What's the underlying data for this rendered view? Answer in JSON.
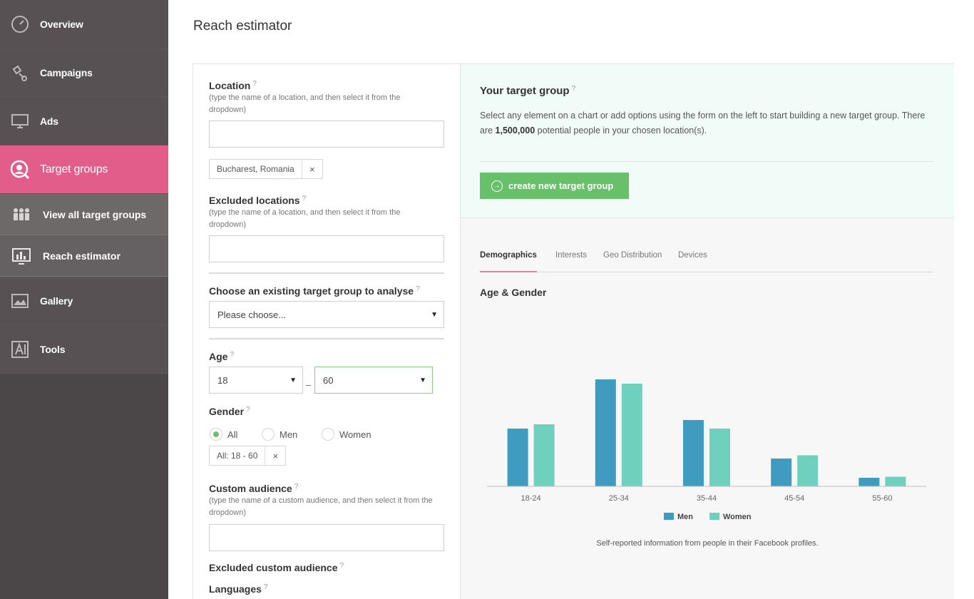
{
  "sidebar": {
    "items": [
      {
        "label": "Overview",
        "icon": "dashboard-gauge-icon"
      },
      {
        "label": "Campaigns",
        "icon": "satellite-icon"
      },
      {
        "label": "Ads",
        "icon": "monitor-icon"
      },
      {
        "label": "Target groups",
        "icon": "target-person-icon",
        "active": true
      },
      {
        "label": "View all target groups",
        "icon": "people-group-icon",
        "sub": true
      },
      {
        "label": "Reach estimator",
        "icon": "bar-chart-screen-icon",
        "sub": true,
        "current": true
      },
      {
        "label": "Gallery",
        "icon": "image-icon"
      },
      {
        "label": "Tools",
        "icon": "tools-icon"
      }
    ]
  },
  "page": {
    "title": "Reach estimator"
  },
  "form": {
    "location": {
      "label": "Location",
      "help": "?",
      "hint": "(type the name of a location, and then select it from the dropdown)",
      "value": ""
    },
    "location_tag": {
      "text": "Bucharest, Romania",
      "remove": "×"
    },
    "excluded_locations": {
      "label": "Excluded locations",
      "help": "?",
      "hint": "(type the name of a location, and then select it from the dropdown)",
      "value": ""
    },
    "existing_group": {
      "label": "Choose an existing target group to analyse",
      "help": "?",
      "selected": "Please choose..."
    },
    "age": {
      "label": "Age",
      "help": "?",
      "from": "18",
      "to": "60",
      "separator": "–"
    },
    "gender": {
      "label": "Gender",
      "help": "?",
      "options": [
        "All",
        "Men",
        "Women"
      ],
      "selected": "All"
    },
    "gender_tag": {
      "text": "All: 18 - 60",
      "remove": "×"
    },
    "custom_audience": {
      "label": "Custom audience",
      "help": "?",
      "hint": "(type the name of a custom audience, and then select it from the dropdown)",
      "value": ""
    },
    "excluded_custom_audience": {
      "label": "Excluded custom audience",
      "help": "?"
    },
    "languages": {
      "label": "Languages",
      "help": "?"
    },
    "arrow": "▼"
  },
  "target_group": {
    "title": "Your target group",
    "help": "?",
    "desc_before": "Select any element on a chart or add options using the form on the left to start building a new target group. There are ",
    "desc_count": "1,500,000",
    "desc_after": " potential people in your chosen location(s).",
    "create_button": "create new target group",
    "create_icon": "→"
  },
  "tabs": [
    "Demographics",
    "Interests",
    "Geo Distribution",
    "Devices"
  ],
  "active_tab": "Demographics",
  "chart_title": "Age & Gender",
  "chart_note": "Self-reported information from people in their Facebook profiles.",
  "chart_data": {
    "type": "bar",
    "categories": [
      "18-24",
      "25-34",
      "35-44",
      "45-54",
      "55-60"
    ],
    "series": [
      {
        "name": "Men",
        "values": [
          54,
          100,
          62,
          26,
          8
        ],
        "color": "#3f9bbf"
      },
      {
        "name": "Women",
        "values": [
          58,
          96,
          54,
          29,
          9
        ],
        "color": "#6fd1bd"
      }
    ],
    "ylim": [
      0,
      100
    ],
    "grid": false,
    "legend": "bottom-center"
  }
}
